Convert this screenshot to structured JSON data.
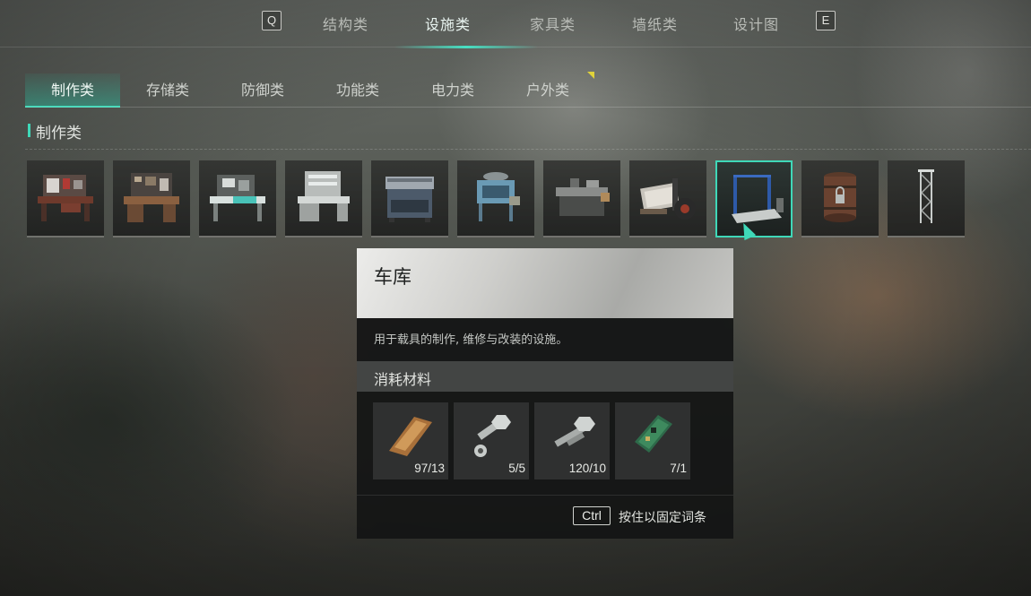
{
  "top_tabs": {
    "left_key": "Q",
    "right_key": "E",
    "tabs": [
      "结构类",
      "设施类",
      "家具类",
      "墙纸类",
      "设计图"
    ],
    "active_index": 1
  },
  "sub_tabs": {
    "tabs": [
      "制作类",
      "存储类",
      "防御类",
      "功能类",
      "电力类",
      "户外类"
    ],
    "active_index": 0
  },
  "section": {
    "title": "制作类"
  },
  "items": [
    {
      "icon": "workbench-red-icon"
    },
    {
      "icon": "workbench-wood-icon"
    },
    {
      "icon": "electronics-bench-icon"
    },
    {
      "icon": "tool-bench-icon"
    },
    {
      "icon": "stove-icon"
    },
    {
      "icon": "furnace-icon"
    },
    {
      "icon": "metal-bench-icon"
    },
    {
      "icon": "loom-icon"
    },
    {
      "icon": "garage-lift-icon"
    },
    {
      "icon": "barrel-icon"
    },
    {
      "icon": "antenna-tower-icon"
    }
  ],
  "selected_item_index": 8,
  "tooltip": {
    "title": "车库",
    "description": "用于载具的制作, 维修与改装的设施。",
    "materials_title": "消耗材料",
    "materials": [
      {
        "icon": "copper-ingot-icon",
        "count": "97/13"
      },
      {
        "icon": "bolt-nut-icon",
        "count": "5/5"
      },
      {
        "icon": "screw-icon",
        "count": "120/10"
      },
      {
        "icon": "circuit-board-icon",
        "count": "7/1"
      }
    ],
    "hold_key": "Ctrl",
    "hold_hint": "按住以固定词条"
  },
  "colors": {
    "accent": "#3fd8b8",
    "marker": "#e0d23a"
  }
}
